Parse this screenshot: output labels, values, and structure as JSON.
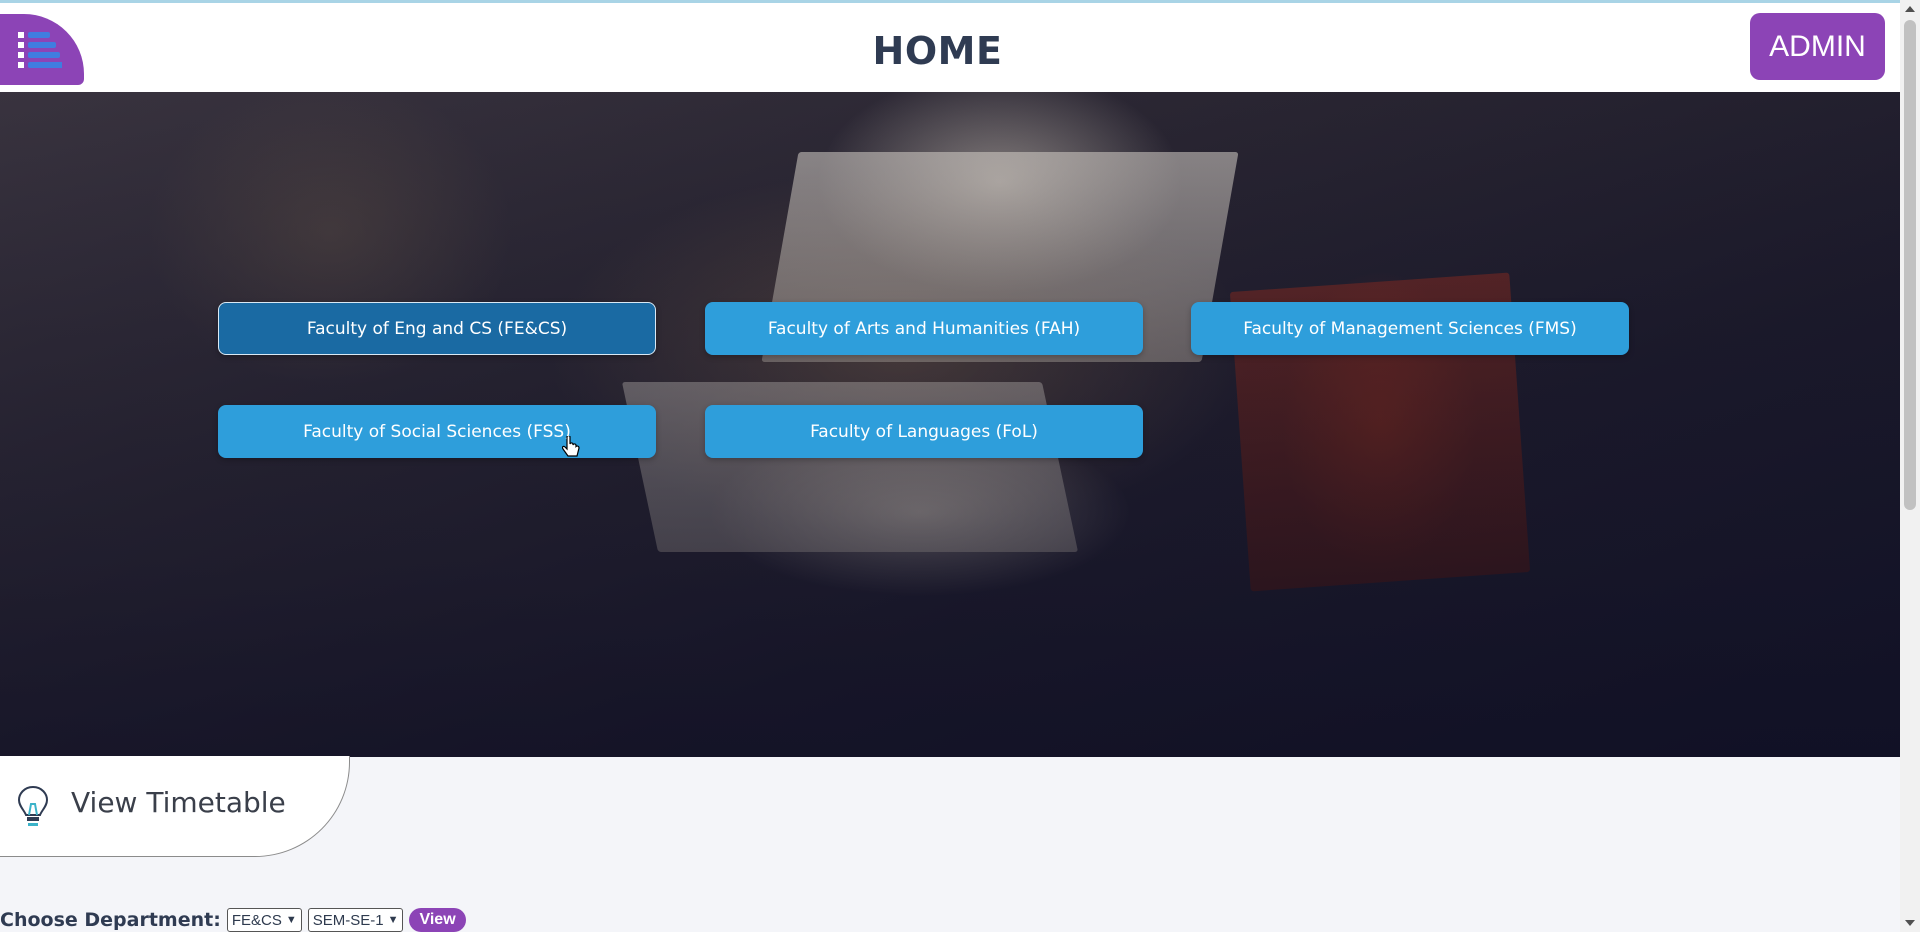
{
  "header": {
    "title": "HOME",
    "admin_label": "ADMIN",
    "menu_icon": "menu-list-icon"
  },
  "faculties": [
    {
      "label": "Faculty of Eng and CS (FE&CS)",
      "active": true
    },
    {
      "label": "Faculty of Arts and Humanities (FAH)",
      "active": false
    },
    {
      "label": "Faculty of Management Sciences (FMS)",
      "active": false
    },
    {
      "label": "Faculty of Social Sciences (FSS)",
      "active": false
    },
    {
      "label": "Faculty of Languages (FoL)",
      "active": false
    }
  ],
  "timetable": {
    "label": "View Timetable",
    "icon": "lightbulb-icon"
  },
  "department": {
    "label": "Choose Department:",
    "department_value": "FE&CS",
    "semester_value": "SEM-SE-1",
    "view_label": "View"
  },
  "colors": {
    "accent_purple": "#8c44b6",
    "faculty_blue": "#2e9edb",
    "faculty_active": "#1a6aa3",
    "title_text": "#2f3b52"
  }
}
